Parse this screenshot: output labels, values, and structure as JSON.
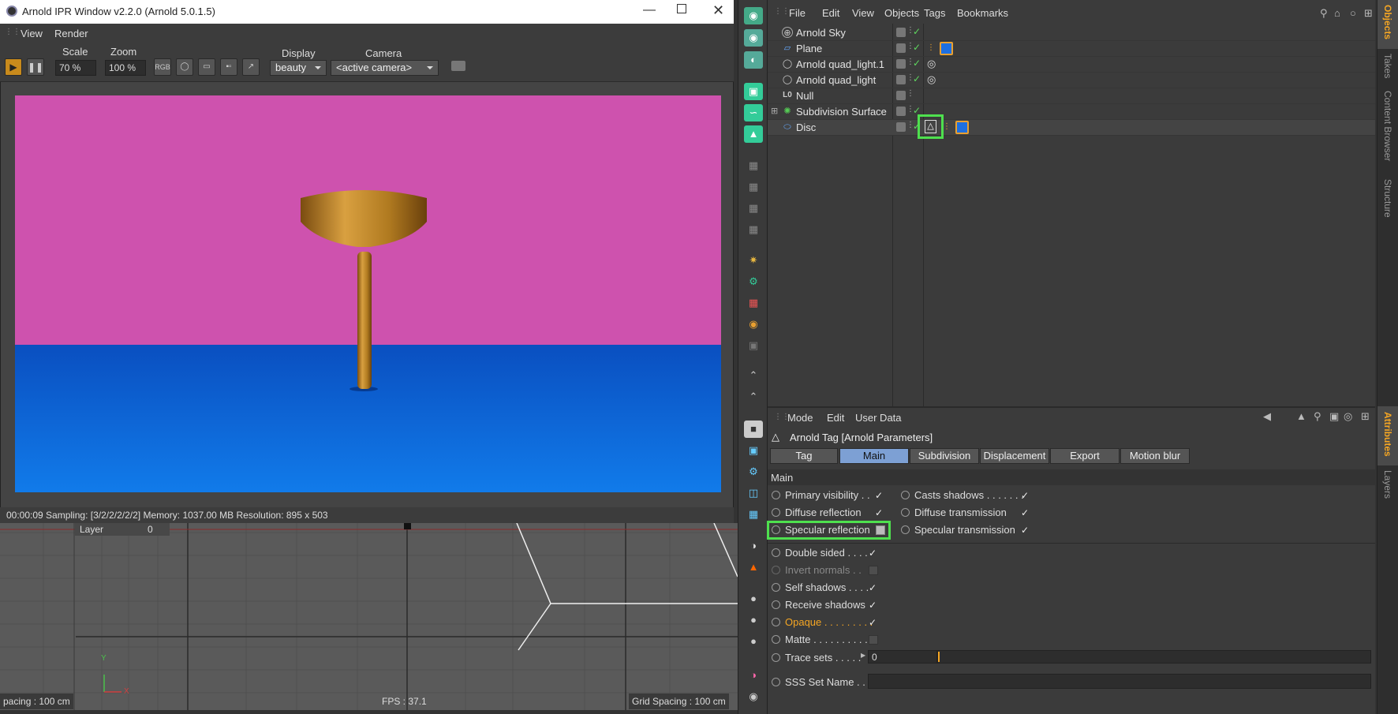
{
  "ipr": {
    "title": "Arnold IPR Window v2.2.0 (Arnold 5.0.1.5)",
    "menu": [
      "View",
      "Render"
    ],
    "scale_label": "Scale",
    "scale_value": "70 %",
    "zoom_label": "Zoom",
    "zoom_value": "100 %",
    "rgb_label": "RGB",
    "display_label": "Display",
    "display_value": "beauty",
    "camera_label": "Camera",
    "camera_value": "<active camera>",
    "status": "00:00:09  Sampling: [3/2/2/2/2/2]  Memory: 1037.00 MB  Resolution: 895 x 503"
  },
  "viewport": {
    "layer_label": "Layer",
    "layer_value": "0",
    "spacing_left": "pacing : 100 cm",
    "fps": "FPS : 37.1",
    "grid_spacing": "Grid Spacing : 100 cm",
    "axis_y": "Y",
    "axis_x": "X"
  },
  "object_manager": {
    "menu": [
      "File",
      "Edit",
      "View",
      "Objects",
      "Tags",
      "Bookmarks"
    ],
    "objects": [
      {
        "name": "Arnold Sky",
        "icon": "sky-icon"
      },
      {
        "name": "Plane",
        "icon": "plane-icon"
      },
      {
        "name": "Arnold quad_light.1",
        "icon": "light-icon"
      },
      {
        "name": "Arnold quad_light",
        "icon": "light-icon"
      },
      {
        "name": "Null",
        "icon": "null-icon"
      },
      {
        "name": "Subdivision Surface",
        "icon": "subdivision-icon"
      },
      {
        "name": "Disc",
        "icon": "disc-icon"
      }
    ]
  },
  "side_tabs": [
    "Objects",
    "Takes",
    "Content Browser",
    "Structure",
    "Attributes",
    "Layers"
  ],
  "attributes": {
    "menu": [
      "Mode",
      "Edit",
      "User Data"
    ],
    "title": "Arnold Tag [Arnold Parameters]",
    "tabs": [
      "Tag",
      "Main",
      "Subdivision",
      "Displacement",
      "Export",
      "Motion blur"
    ],
    "active_tab": "Main",
    "section": "Main",
    "params": {
      "primary_visibility": "Primary visibility . .",
      "casts_shadows": "Casts shadows . . . . . . .",
      "diffuse_reflection": "Diffuse reflection",
      "diffuse_transmission": "Diffuse transmission",
      "specular_reflection": "Specular reflection",
      "specular_transmission": "Specular transmission",
      "double_sided": "Double sided . . . .",
      "invert_normals": "Invert normals . .",
      "self_shadows": "Self shadows . . . .",
      "receive_shadows": "Receive shadows",
      "opaque": "Opaque . . . . . . . . .",
      "matte": "Matte . . . . . . . . . . .",
      "trace_sets": "Trace sets . . . . .",
      "trace_sets_value": "0",
      "sss_set_name": "SSS Set Name . . ."
    },
    "accent_color": "#f5a623",
    "highlight_color": "#4ee04e"
  }
}
